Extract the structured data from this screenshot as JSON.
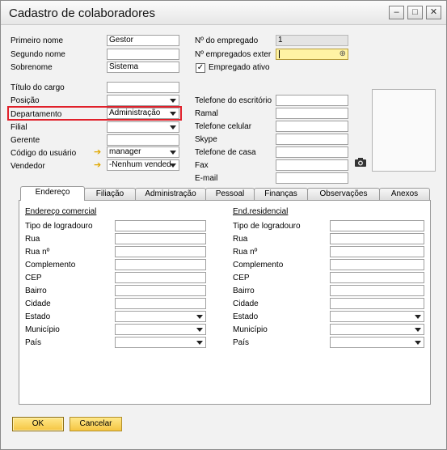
{
  "window": {
    "title": "Cadastro de colaboradores",
    "minimize": "–",
    "maximize": "□",
    "close": "✕"
  },
  "left": {
    "primeiro_nome": {
      "label": "Primeiro nome",
      "value": "Gestor"
    },
    "segundo_nome": {
      "label": "Segundo nome",
      "value": ""
    },
    "sobrenome": {
      "label": "Sobrenome",
      "value": "Sistema"
    },
    "titulo_cargo": {
      "label": "Título do cargo",
      "value": ""
    },
    "posicao": {
      "label": "Posição",
      "value": ""
    },
    "departamento": {
      "label": "Departamento",
      "value": "Administração"
    },
    "filial": {
      "label": "Filial",
      "value": ""
    },
    "gerente": {
      "label": "Gerente",
      "value": ""
    },
    "codigo_usuario": {
      "label": "Código do usuário",
      "value": "manager"
    },
    "vendedor": {
      "label": "Vendedor",
      "value": "-Nenhum vended"
    }
  },
  "right": {
    "num_empregado": {
      "label": "Nº do empregado",
      "value": "1"
    },
    "num_externo": {
      "label": "Nº empregados exter",
      "value": ""
    },
    "empregado_ativo": {
      "label": "Empregado ativo",
      "checked": true,
      "check_glyph": "✓"
    },
    "tel_escritorio": {
      "label": "Telefone do escritório",
      "value": ""
    },
    "ramal": {
      "label": "Ramal",
      "value": ""
    },
    "tel_celular": {
      "label": "Telefone celular",
      "value": ""
    },
    "skype": {
      "label": "Skype",
      "value": ""
    },
    "tel_casa": {
      "label": "Telefone de casa",
      "value": ""
    },
    "fax": {
      "label": "Fax",
      "value": ""
    },
    "email": {
      "label": "E-mail",
      "value": ""
    }
  },
  "tabs": [
    "Endereço",
    "Filiação",
    "Administração",
    "Pessoal",
    "Finanças",
    "Observações",
    "Anexos"
  ],
  "active_tab": "Endereço",
  "address": {
    "comercial_title": "Endereço comercial",
    "residencial_title": "End.residencial",
    "fields": [
      "Tipo de logradouro",
      "Rua",
      "Rua nº",
      "Complemento",
      "CEP",
      "Bairro",
      "Cidade",
      "Estado",
      "Município",
      "País"
    ]
  },
  "buttons": {
    "ok": "OK",
    "cancel": "Cancelar"
  },
  "colors": {
    "accent_yellow": "#f5c542",
    "highlight_red": "#e0202a",
    "active_field": "#fff3a4"
  },
  "icons": {
    "link_arrow": "arrow-right-icon",
    "camera": "camera-icon",
    "search": "search-icon"
  }
}
